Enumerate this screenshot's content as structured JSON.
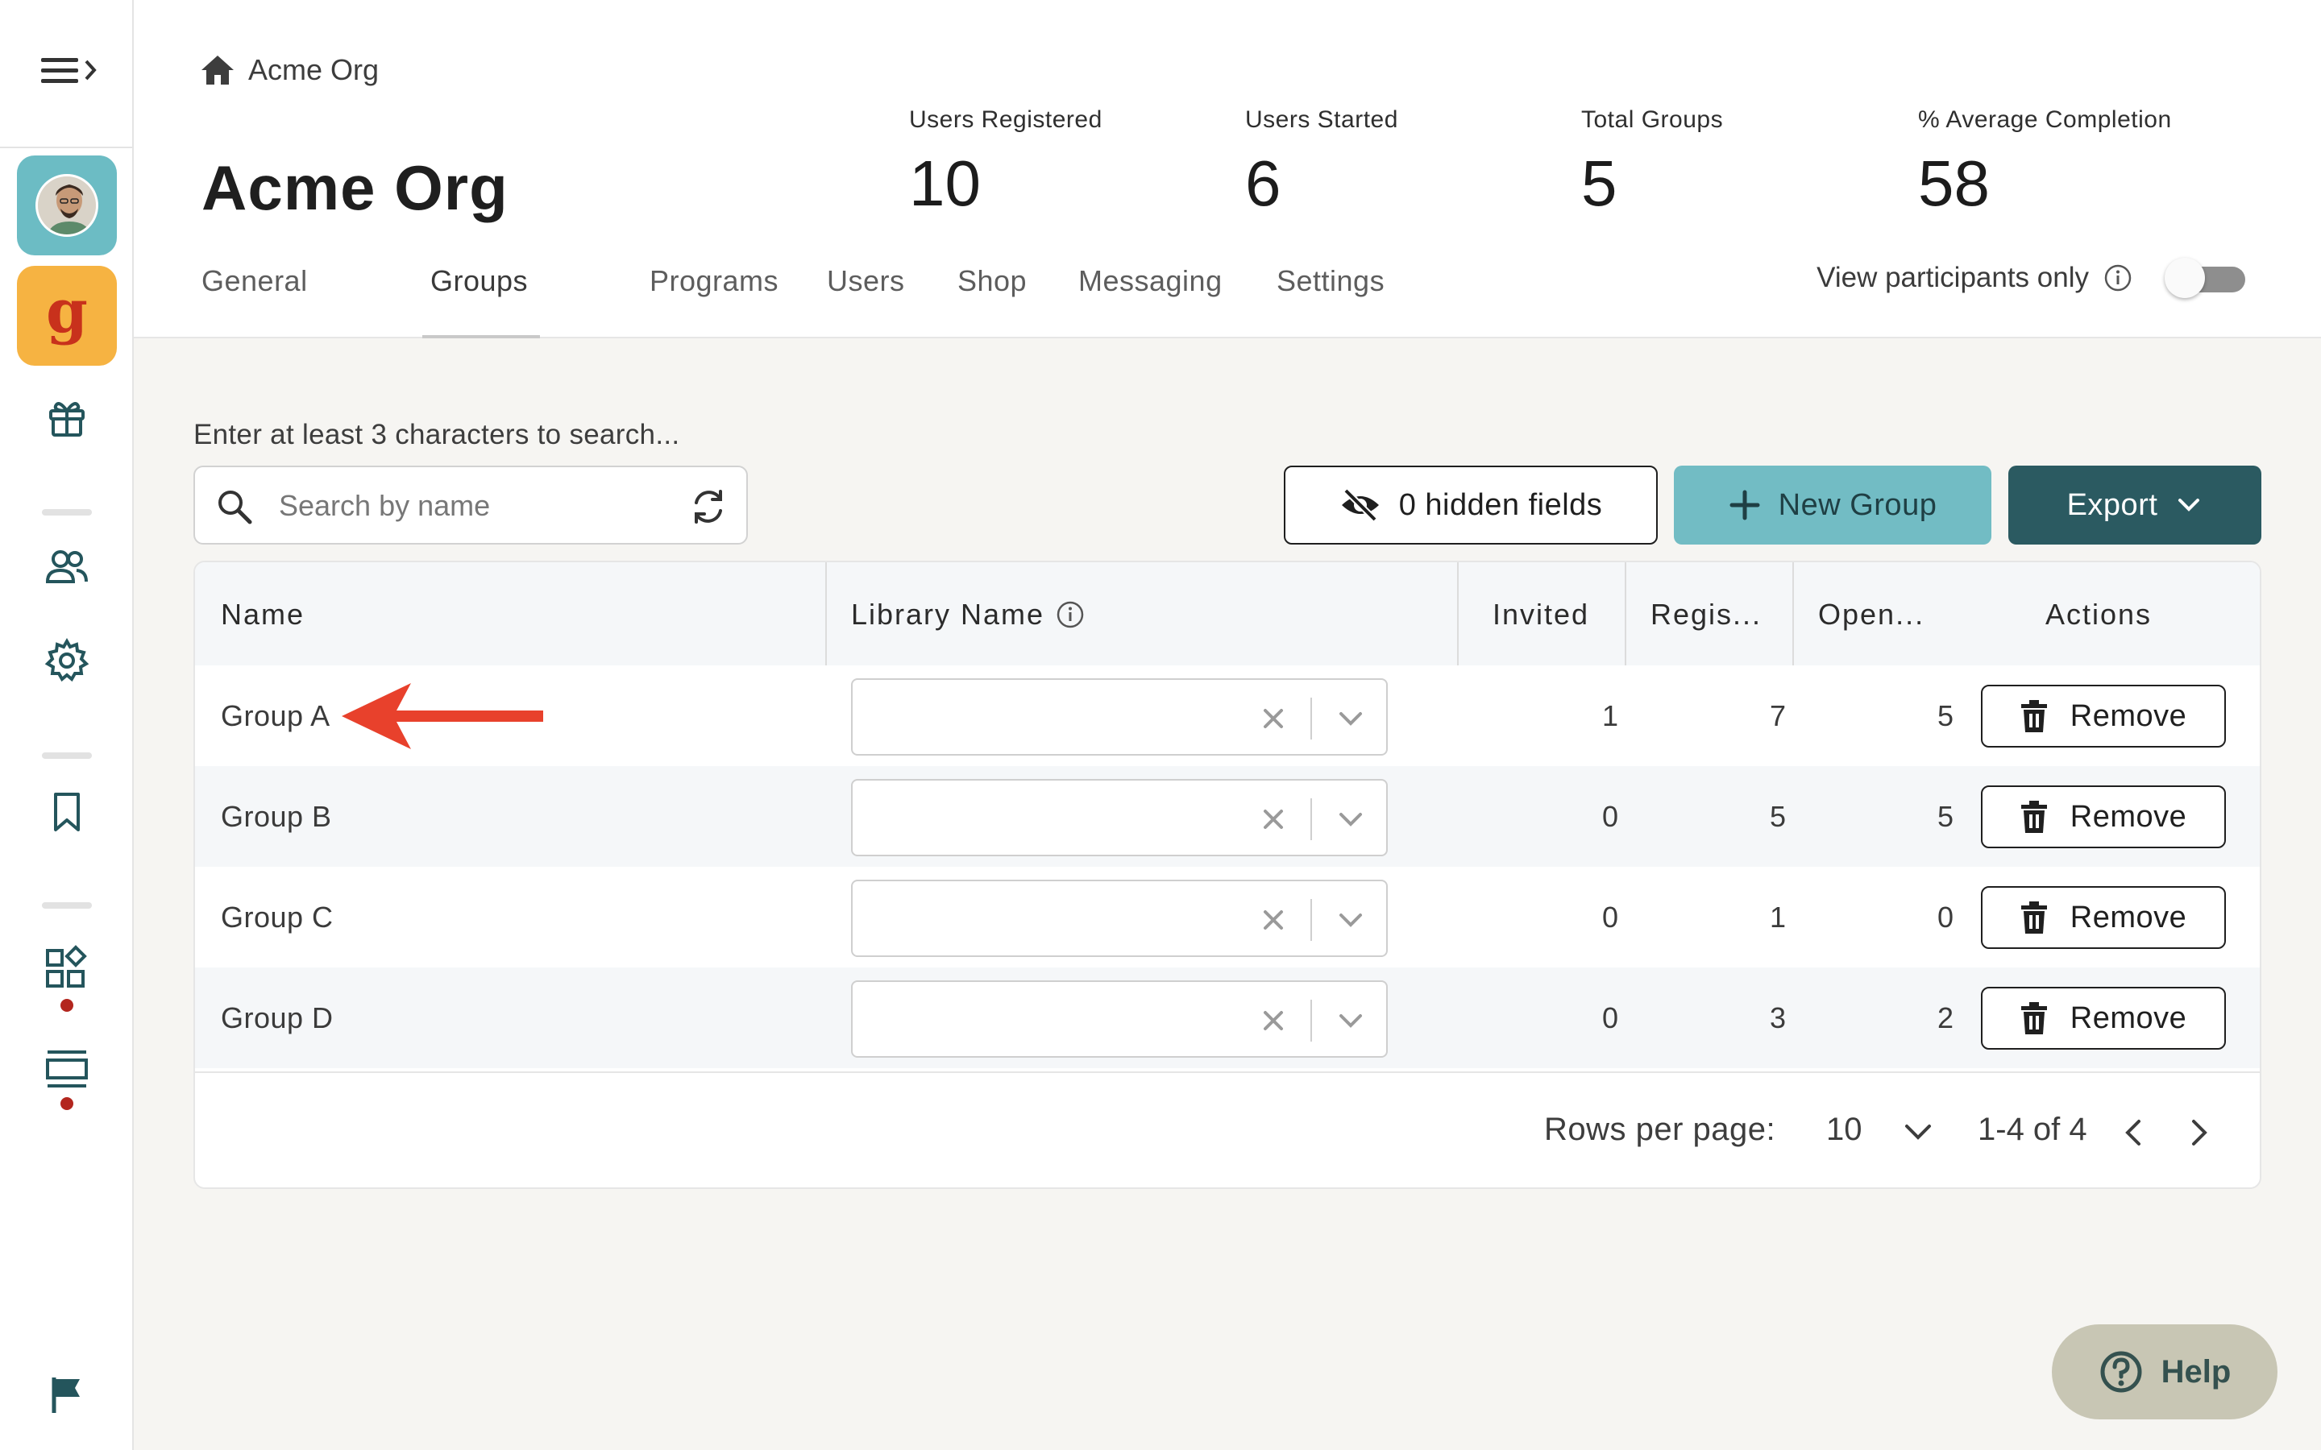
{
  "breadcrumb": {
    "label": "Acme Org"
  },
  "page": {
    "title": "Acme Org"
  },
  "stats": [
    {
      "label": "Users Registered",
      "value": "10"
    },
    {
      "label": "Users Started",
      "value": "6"
    },
    {
      "label": "Total Groups",
      "value": "5"
    },
    {
      "label": "% Average Completion",
      "value": "58"
    }
  ],
  "tabs": [
    {
      "label": "General"
    },
    {
      "label": "Groups",
      "active": true
    },
    {
      "label": "Programs"
    },
    {
      "label": "Users"
    },
    {
      "label": "Shop"
    },
    {
      "label": "Messaging"
    },
    {
      "label": "Settings"
    }
  ],
  "view_toggle": {
    "label": "View participants only",
    "on": false
  },
  "search": {
    "hint": "Enter at least 3 characters to search...",
    "placeholder": "Search by name",
    "value": ""
  },
  "toolbar": {
    "hidden_fields_label": "0 hidden fields",
    "new_group_label": "New Group",
    "export_label": "Export"
  },
  "table": {
    "columns": [
      "Name",
      "Library Name",
      "Invited",
      "Regis...",
      "Open...",
      "Actions"
    ],
    "rows": [
      {
        "name": "Group A",
        "library": "",
        "invited": "1",
        "registered": "7",
        "opened": "5",
        "action": "Remove"
      },
      {
        "name": "Group B",
        "library": "",
        "invited": "0",
        "registered": "5",
        "opened": "5",
        "action": "Remove"
      },
      {
        "name": "Group C",
        "library": "",
        "invited": "0",
        "registered": "1",
        "opened": "0",
        "action": "Remove"
      },
      {
        "name": "Group D",
        "library": "",
        "invited": "0",
        "registered": "3",
        "opened": "2",
        "action": "Remove"
      }
    ]
  },
  "pagination": {
    "rows_per_page_label": "Rows per page:",
    "rows_per_page": "10",
    "range": "1-4 of 4"
  },
  "help": {
    "label": "Help"
  },
  "colors": {
    "accent": "#72bcc4",
    "primary_dark": "#2b5a61",
    "brand_orange": "#f6b342",
    "alert_red": "#e8412c"
  }
}
